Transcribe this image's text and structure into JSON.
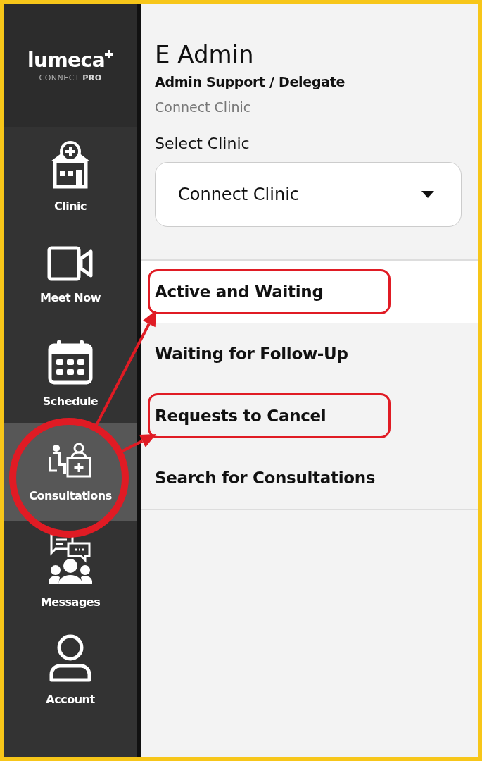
{
  "logo": {
    "name": "lumeca",
    "tagline": "CONNECT **PRO**"
  },
  "sidebar": {
    "items": [
      {
        "label": "Clinic",
        "kind": "clinic",
        "selected": false,
        "highlighted": false
      },
      {
        "label": "Meet Now",
        "kind": "video",
        "selected": false,
        "highlighted": false
      },
      {
        "label": "Schedule",
        "kind": "calendar",
        "selected": false,
        "highlighted": false
      },
      {
        "label": "Consultations",
        "kind": "consult",
        "selected": true,
        "highlighted": true
      },
      {
        "label": "Messages",
        "kind": "messages",
        "selected": false,
        "highlighted": false
      },
      {
        "label": "Account",
        "kind": "account",
        "selected": false,
        "highlighted": false
      }
    ]
  },
  "user": {
    "name": "E Admin",
    "role": "Admin Support / Delegate",
    "clinic": "Connect Clinic"
  },
  "clinic_select": {
    "label": "Select Clinic",
    "value": "Connect Clinic"
  },
  "menu": {
    "items": [
      {
        "label": "Active and Waiting",
        "selected": true,
        "highlighted": true
      },
      {
        "label": "Waiting for Follow-Up",
        "selected": false,
        "highlighted": false
      },
      {
        "label": "Requests to Cancel",
        "selected": false,
        "highlighted": true
      },
      {
        "label": "Search for Consultations",
        "selected": false,
        "highlighted": false
      }
    ]
  }
}
